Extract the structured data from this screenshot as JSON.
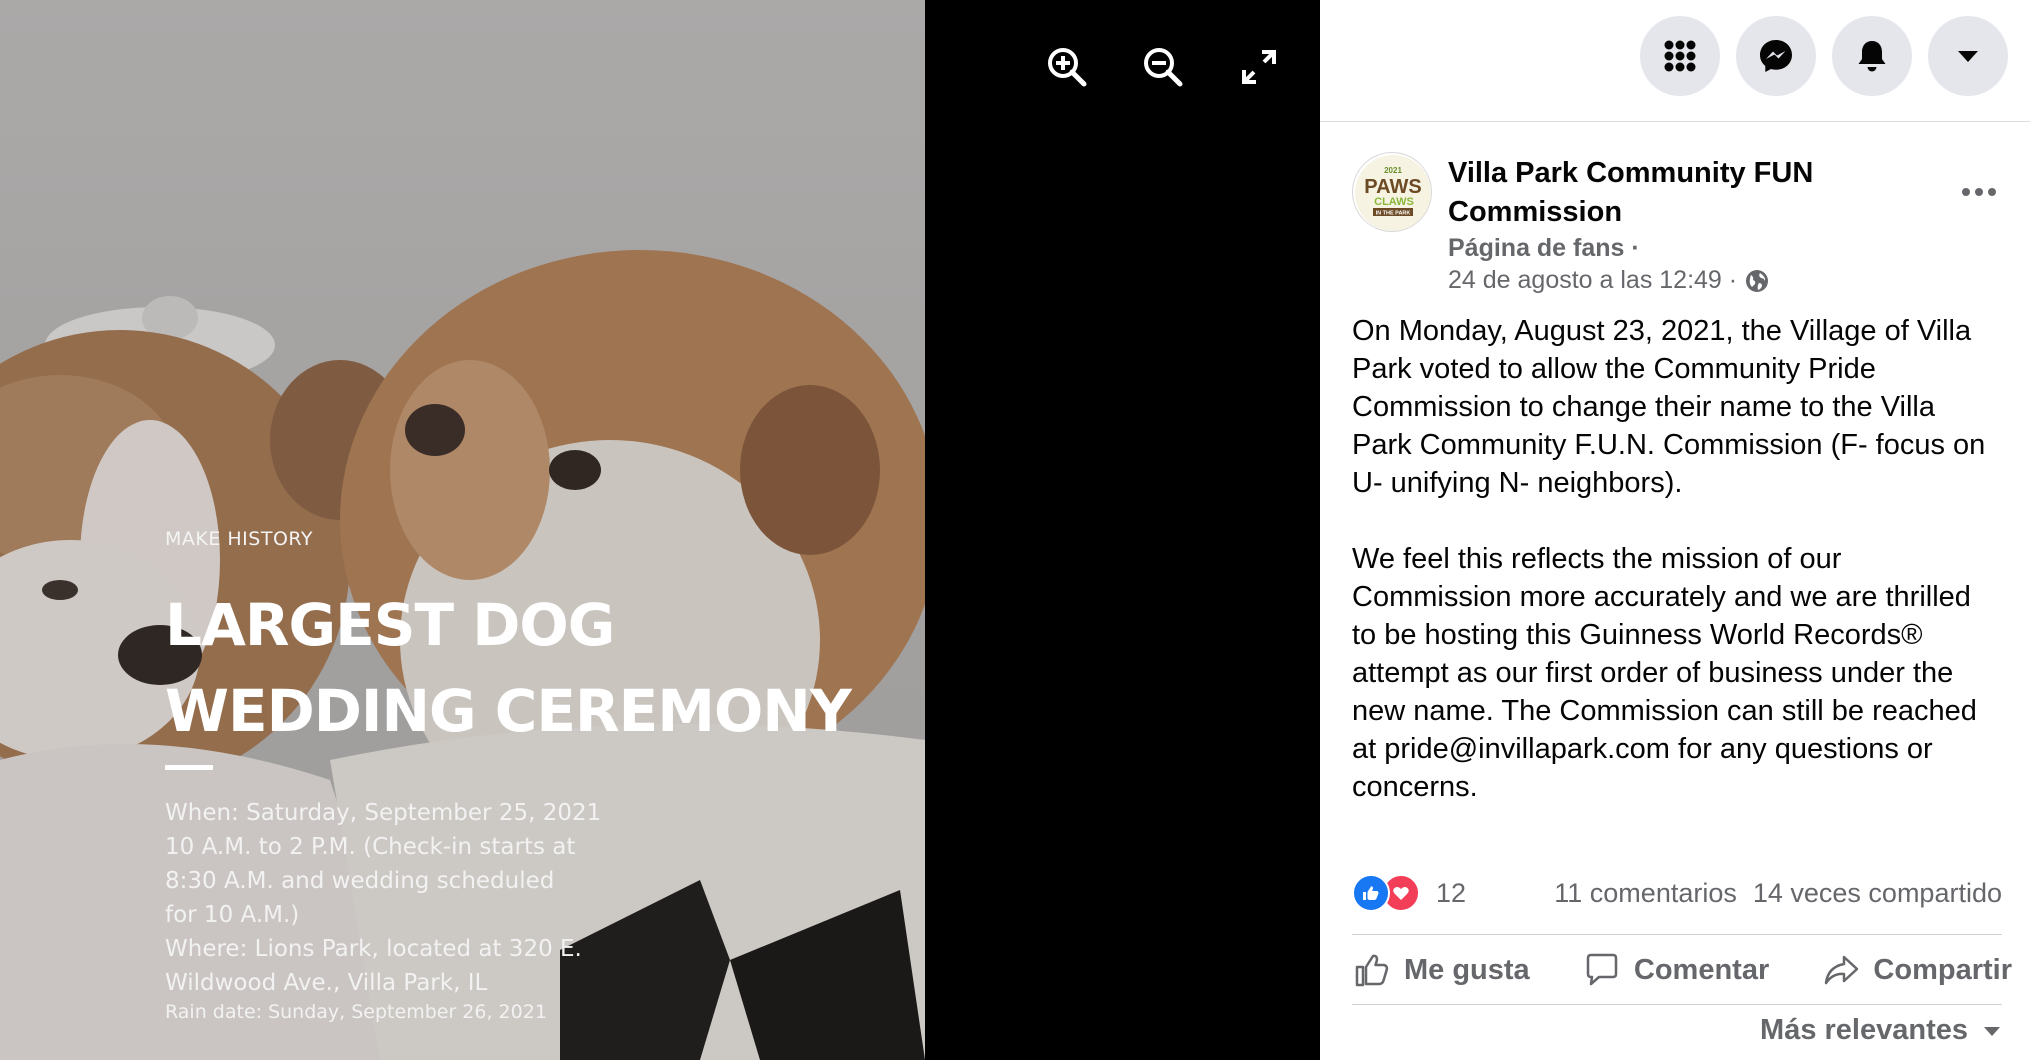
{
  "viewer": {
    "promo": {
      "kicker": "MAKE HISTORY",
      "title_line1": "LARGEST DOG",
      "title_line2": "WEDDING CEREMONY",
      "details": [
        "When: Saturday, September 25, 2021",
        "10 A.M. to 2 P.M. (Check-in starts at",
        "8:30 A.M. and wedding scheduled",
        "for 10 A.M.)",
        "Where: Lions Park, located at 320 E.",
        "Wildwood Ave., Villa Park, IL"
      ],
      "rain_date": "Rain date: Sunday, September 26, 2021"
    },
    "tools": [
      "zoom-in-icon",
      "zoom-out-icon",
      "fullscreen-icon"
    ]
  },
  "topbar": {
    "buttons": [
      "menu-grid-icon",
      "messenger-icon",
      "notifications-bell-icon",
      "account-caret-icon"
    ]
  },
  "post": {
    "avatar": {
      "year": "2021",
      "line1": "PAWS",
      "line2": "CLAWS",
      "line3": "IN THE PARK"
    },
    "page_name": "Villa Park Community FUN Commission",
    "page_type": "Página de fans ·",
    "timestamp": "24 de agosto a las 12:49 ·",
    "paragraph1": "On Monday, August 23, 2021, the Village of Villa Park voted to allow the Community Pride Commission to change their name to the Villa Park Community F.U.N. Commission (F- focus on U- unifying N- neighbors).",
    "paragraph2": "We feel this reflects the mission of our Commission more accurately and we are thrilled to be hosting this Guinness World Records® attempt as our first order of business under the new name. The Commission can still be reached at pride@invillapark.com for any questions or concerns.",
    "reaction_count": "12",
    "comments": "11 comentarios",
    "shares": "14 veces compartido",
    "actions": {
      "like": "Me gusta",
      "comment": "Comentar",
      "share": "Compartir"
    },
    "sort_label": "Más relevantes",
    "colors": {
      "like_blue": "#1877f2",
      "love_red": "#f33e58",
      "secondary_text": "#65676b"
    }
  }
}
